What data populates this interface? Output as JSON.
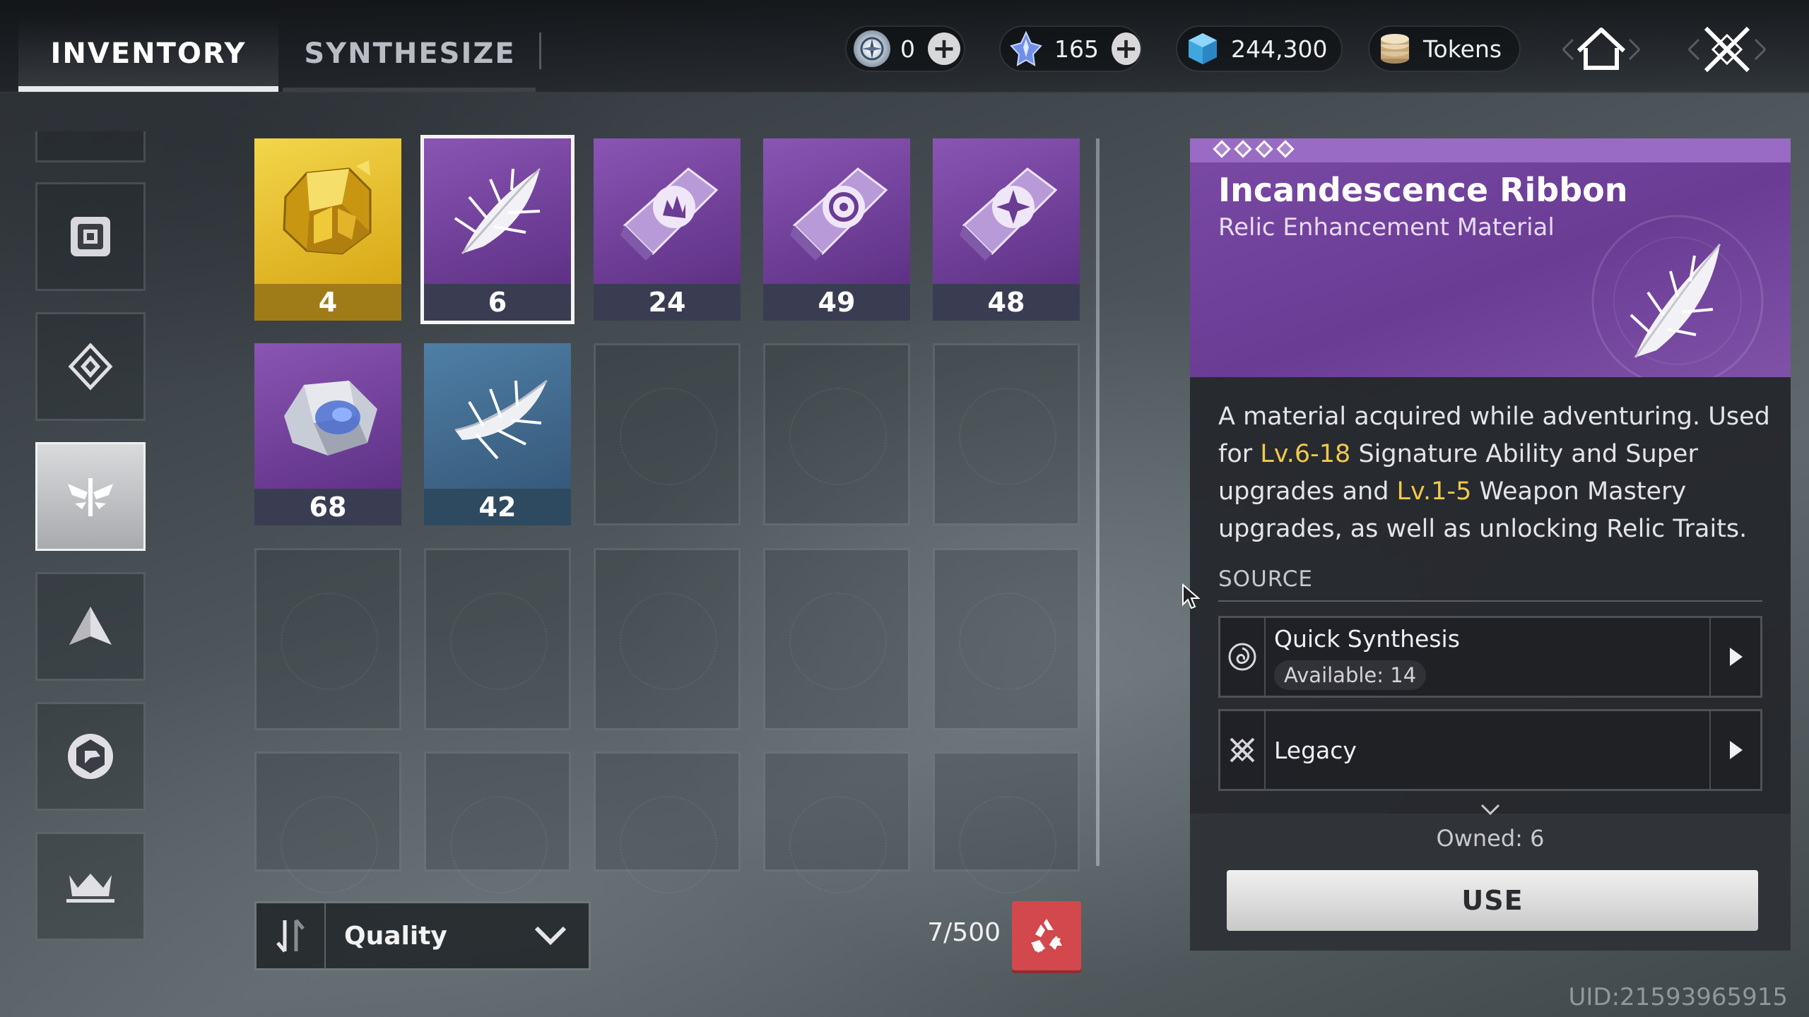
{
  "tabs": [
    {
      "label": "INVENTORY",
      "active": true
    },
    {
      "label": "SYNTHESIZE",
      "active": false
    }
  ],
  "currencies": [
    {
      "icon": "compass-coin-icon",
      "value": "0",
      "addable": true
    },
    {
      "icon": "blue-crystal-icon",
      "value": "165",
      "addable": true
    },
    {
      "icon": "blue-cube-icon",
      "value": "244,300",
      "addable": false
    },
    {
      "icon": "token-stack-icon",
      "value": "Tokens",
      "addable": false
    }
  ],
  "nav": {
    "home_icon": "home-icon",
    "close_icon": "close-icon"
  },
  "sidebar": {
    "items": [
      {
        "icon": "chip-icon",
        "active": false
      },
      {
        "icon": "diamond-emblem-icon",
        "active": false
      },
      {
        "icon": "winged-relic-icon",
        "active": true
      },
      {
        "icon": "triangle-icon",
        "active": false
      },
      {
        "icon": "hexagon-shard-icon",
        "active": false
      },
      {
        "icon": "crown-icon",
        "active": false
      }
    ]
  },
  "inventory": {
    "items": [
      {
        "name": "gold-ore",
        "count": "4",
        "rarity": "gold"
      },
      {
        "name": "incandescence-ribbon",
        "count": "6",
        "rarity": "purple",
        "selected": true
      },
      {
        "name": "crest-crystal-fire",
        "count": "24",
        "rarity": "purple"
      },
      {
        "name": "crest-crystal-target",
        "count": "49",
        "rarity": "purple"
      },
      {
        "name": "crest-crystal-star",
        "count": "48",
        "rarity": "purple"
      },
      {
        "name": "void-stone",
        "count": "68",
        "rarity": "purple"
      },
      {
        "name": "white-feather",
        "count": "42",
        "rarity": "blue"
      }
    ],
    "sort_label": "Quality",
    "capacity": "7/500"
  },
  "detail": {
    "stars": 4,
    "title": "Incandescence Ribbon",
    "subtitle": "Relic Enhancement Material",
    "desc_part1": "A material acquired while adventuring. Used for ",
    "desc_hl1": "Lv.6-18",
    "desc_part2": " Signature Ability and Super upgrades and ",
    "desc_hl2": "Lv.1-5",
    "desc_part3": " Weapon Mastery upgrades, as well as unlocking Relic Traits.",
    "source_label": "SOURCE",
    "sources": [
      {
        "name": "Quick Synthesis",
        "available": "Available: 14"
      },
      {
        "name": "Legacy"
      }
    ],
    "owned": "Owned: 6",
    "use_label": "USE"
  },
  "uid": "UID:21593965915",
  "colors": {
    "accent_purple": "#7a4aa5",
    "highlight_yellow": "#f1c94a",
    "recycle_red": "#d2484c"
  }
}
